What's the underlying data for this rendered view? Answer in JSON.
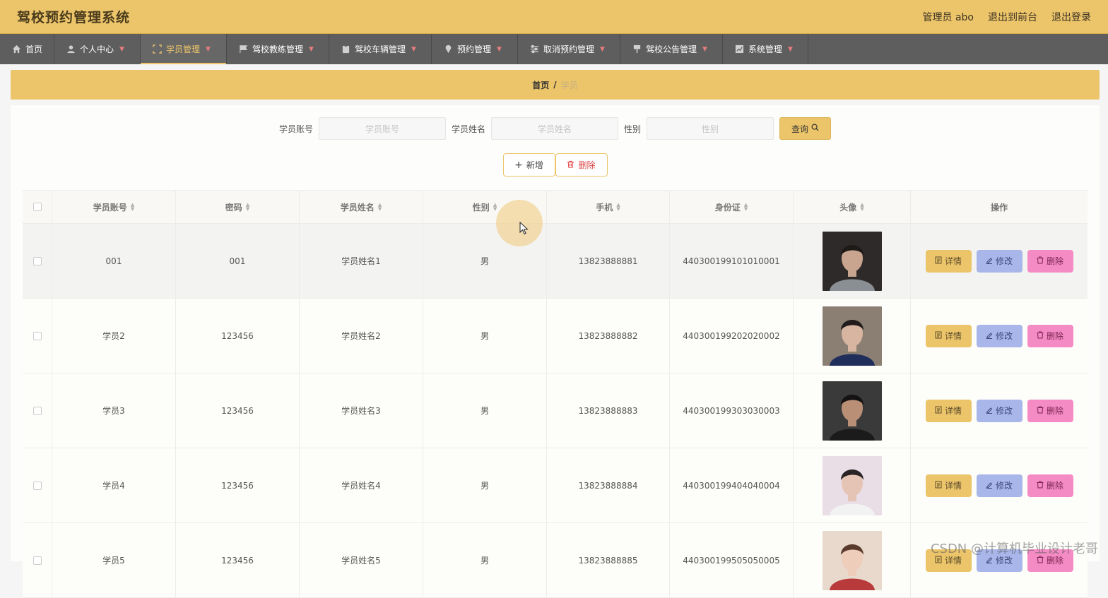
{
  "header": {
    "title": "驾校预约管理系统",
    "links": [
      "管理员 abo",
      "退出到前台",
      "退出登录"
    ]
  },
  "nav": [
    {
      "label": "首页",
      "icon": "home-icon"
    },
    {
      "label": "个人中心",
      "icon": "user-icon"
    },
    {
      "label": "学员管理",
      "icon": "expand-icon"
    },
    {
      "label": "驾校教练管理",
      "icon": "flag-icon"
    },
    {
      "label": "驾校车辆管理",
      "icon": "clipboard-icon"
    },
    {
      "label": "预约管理",
      "icon": "location-icon"
    },
    {
      "label": "取消预约管理",
      "icon": "sliders-icon"
    },
    {
      "label": "驾校公告管理",
      "icon": "pin-icon"
    },
    {
      "label": "系统管理",
      "icon": "chart-icon"
    }
  ],
  "breadcrumb": {
    "home": "首页",
    "sep": "/",
    "current": "学员"
  },
  "search": {
    "account_label": "学员账号",
    "account_placeholder": "学员账号",
    "name_label": "学员姓名",
    "name_placeholder": "学员姓名",
    "gender_label": "性别",
    "gender_placeholder": "性别",
    "query_label": "查询"
  },
  "actions": {
    "add_label": "新增",
    "delete_label": "删除"
  },
  "table": {
    "columns": [
      "学员账号",
      "密码",
      "学员姓名",
      "性别",
      "手机",
      "身份证",
      "头像",
      "操作"
    ],
    "rows": [
      {
        "account": "001",
        "password": "001",
        "name": "学员姓名1",
        "gender": "男",
        "phone": "13823888881",
        "idcard": "440300199101010001"
      },
      {
        "account": "学员2",
        "password": "123456",
        "name": "学员姓名2",
        "gender": "男",
        "phone": "13823888882",
        "idcard": "440300199202020002"
      },
      {
        "account": "学员3",
        "password": "123456",
        "name": "学员姓名3",
        "gender": "男",
        "phone": "13823888883",
        "idcard": "440300199303030003"
      },
      {
        "account": "学员4",
        "password": "123456",
        "name": "学员姓名4",
        "gender": "男",
        "phone": "13823888884",
        "idcard": "440300199404040004"
      },
      {
        "account": "学员5",
        "password": "123456",
        "name": "学员姓名5",
        "gender": "男",
        "phone": "13823888885",
        "idcard": "440300199505050005"
      }
    ],
    "ops": {
      "detail": "详情",
      "edit": "修改",
      "delete": "删除"
    }
  },
  "watermark": "CSDN @计算机毕业设计老哥",
  "colors": {
    "accent": "#ecc56a",
    "nav_bg": "#5e5e5e",
    "edit": "#a8b6ea",
    "delete": "#f58bc4"
  }
}
